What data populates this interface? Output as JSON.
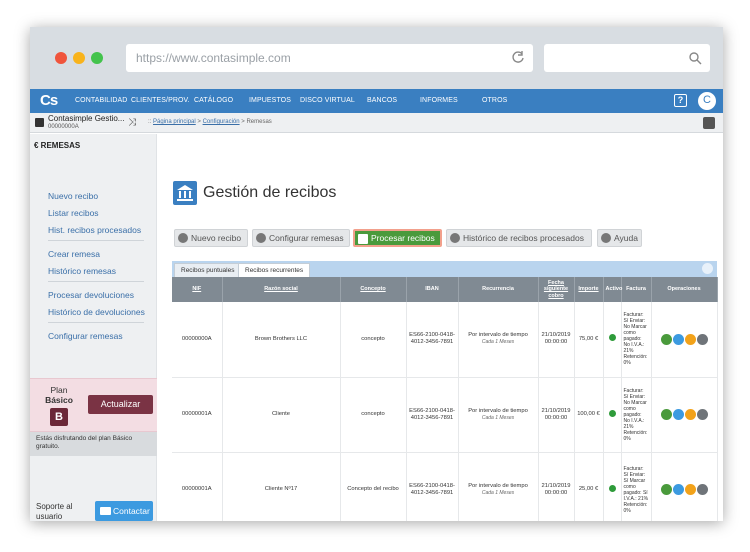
{
  "browser": {
    "url": "https://www.contasimple.com"
  },
  "nav": {
    "logo": "Cs",
    "items": [
      "CONTABILIDAD",
      "CLIENTES/PROV.",
      "CATÁLOGO",
      "IMPUESTOS",
      "DISCO VIRTUAL",
      "BANCOS",
      "INFORMES",
      "OTROS"
    ],
    "avatar_initial": "C"
  },
  "subheader": {
    "company_name": "Contasimple Gestio...",
    "company_id": "00000000A",
    "breadcrumb_home": "Página principal",
    "breadcrumb_config": "Configuración",
    "breadcrumb_current": "Remesas",
    "breadcrumb_prefix": "::"
  },
  "sidebar": {
    "section_title": "REMESAS",
    "links": [
      "Nuevo recibo",
      "Listar recibos",
      "Hist. recibos procesados",
      "Crear remesa",
      "Histórico remesas",
      "Procesar devoluciones",
      "Histórico de devoluciones",
      "Configurar remesas"
    ],
    "plan_label": "Plan",
    "plan_name": "Básico",
    "plan_letter": "B",
    "upgrade_label": "Actualizar",
    "plan_note": "Estás disfrutando del plan Básico gratuito.",
    "support_label": "Soporte al usuario",
    "contact_label": "Contactar"
  },
  "main": {
    "title": "Gestión de recibos",
    "toolbar": [
      "Nuevo recibo",
      "Configurar remesas",
      "Procesar recibos",
      "Histórico de recibos procesados",
      "Ayuda"
    ],
    "tabs": [
      "Recibos puntuales",
      "Recibos recurrentes"
    ],
    "columns": [
      "NIF",
      "Razón social",
      "Concepto",
      "IBAN",
      "Recurrencia",
      "Fecha siguiente cobro",
      "Importe",
      "Activo",
      "Factura",
      "Operaciones"
    ],
    "rows": [
      {
        "nif": "00000000A",
        "razon": "Brown Brothers LLC",
        "concepto": "concepto",
        "iban": "ES66-2100-0418-4012-3456-7891",
        "recurrencia": "Por intervalo de tiempo",
        "recurrencia_sub": "Cada 1 Meses",
        "fecha": "21/10/2019 00:00:00",
        "importe": "75,00 €",
        "factura": "Facturar: Sí Enviar: No Marcar como pagado: No I.V.A.: 21% Retención: 0%"
      },
      {
        "nif": "00000001A",
        "razon": "Cliente",
        "concepto": "concepto",
        "iban": "ES66-2100-0418-4012-3456-7891",
        "recurrencia": "Por intervalo de tiempo",
        "recurrencia_sub": "Cada 1 Meses",
        "fecha": "21/10/2019 00:00:00",
        "importe": "100,00 €",
        "factura": "Facturar: Sí Enviar: No Marcar como pagado: No I.V.A.: 21% Retención: 0%"
      },
      {
        "nif": "00000001A",
        "razon": "Cliente Nº17",
        "concepto": "Concepto del recibo",
        "iban": "ES66-2100-0418-4012-3456-7891",
        "recurrencia": "Por intervalo de tiempo",
        "recurrencia_sub": "Cada 1 Meses",
        "fecha": "21/10/2019 00:00:00",
        "importe": "25,00 €",
        "factura": "Facturar: Sí Enviar: Sí Marcar como pagado: Sí I.V.A.: 21% Retención: 0%"
      }
    ]
  },
  "colors": {
    "nav": "#3a7fc1",
    "primary_button": "#4a9a3c",
    "plan_accent": "#7a3344"
  }
}
